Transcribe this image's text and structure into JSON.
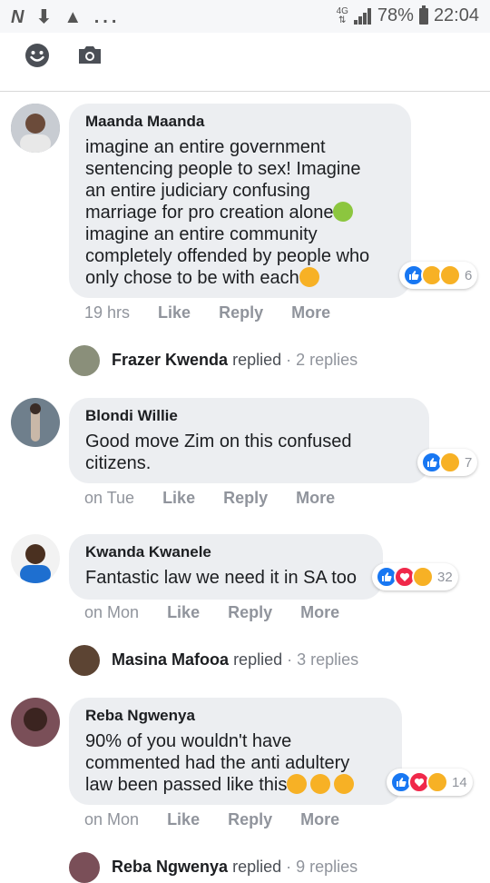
{
  "status_bar": {
    "left_icons": [
      "N",
      "download-icon",
      "warning-icon",
      "..."
    ],
    "network": "4G",
    "battery": "78%",
    "time": "22:04"
  },
  "toolbar": {
    "icons": [
      "emoji-icon",
      "camera-icon"
    ]
  },
  "action_labels": {
    "like": "Like",
    "reply": "Reply",
    "more": "More"
  },
  "comments": [
    {
      "name": "Maanda Maanda",
      "lines": [
        "imagine an entire government",
        "sentencing people to sex! Imagine",
        "an entire judiciary confusing",
        "marriage for pro creation alone",
        "imagine an entire community",
        "completely offended by people who",
        "only chose to be with each"
      ],
      "time": "19 hrs",
      "reaction_count": "6",
      "reactions": [
        "like",
        "haha",
        "sad"
      ]
    },
    {
      "name": "Blondi Willie",
      "lines": [
        "Good move Zim on this confused",
        "citizens."
      ],
      "time": "on Tue",
      "reaction_count": "7",
      "reactions": [
        "like",
        "haha"
      ]
    },
    {
      "name": "Kwanda Kwanele",
      "lines": [
        "Fantastic law we need it in SA too"
      ],
      "time": "on Mon",
      "reaction_count": "32",
      "reactions": [
        "like",
        "love",
        "haha"
      ]
    },
    {
      "name": "Reba Ngwenya",
      "lines": [
        "90% of you wouldn't have",
        "commented had the anti adultery",
        "law been passed like this"
      ],
      "time": "on Mon",
      "reaction_count": "14",
      "reactions": [
        "like",
        "love",
        "haha"
      ]
    }
  ],
  "reply_rows": [
    {
      "name": "Frazer Kwenda",
      "verb": "replied",
      "count": "· 2 replies"
    },
    {
      "name": "Masina Mafooa",
      "verb": "replied",
      "count": "· 3 replies"
    },
    {
      "name": "Reba Ngwenya",
      "verb": "replied",
      "count": "· 9 replies"
    }
  ]
}
